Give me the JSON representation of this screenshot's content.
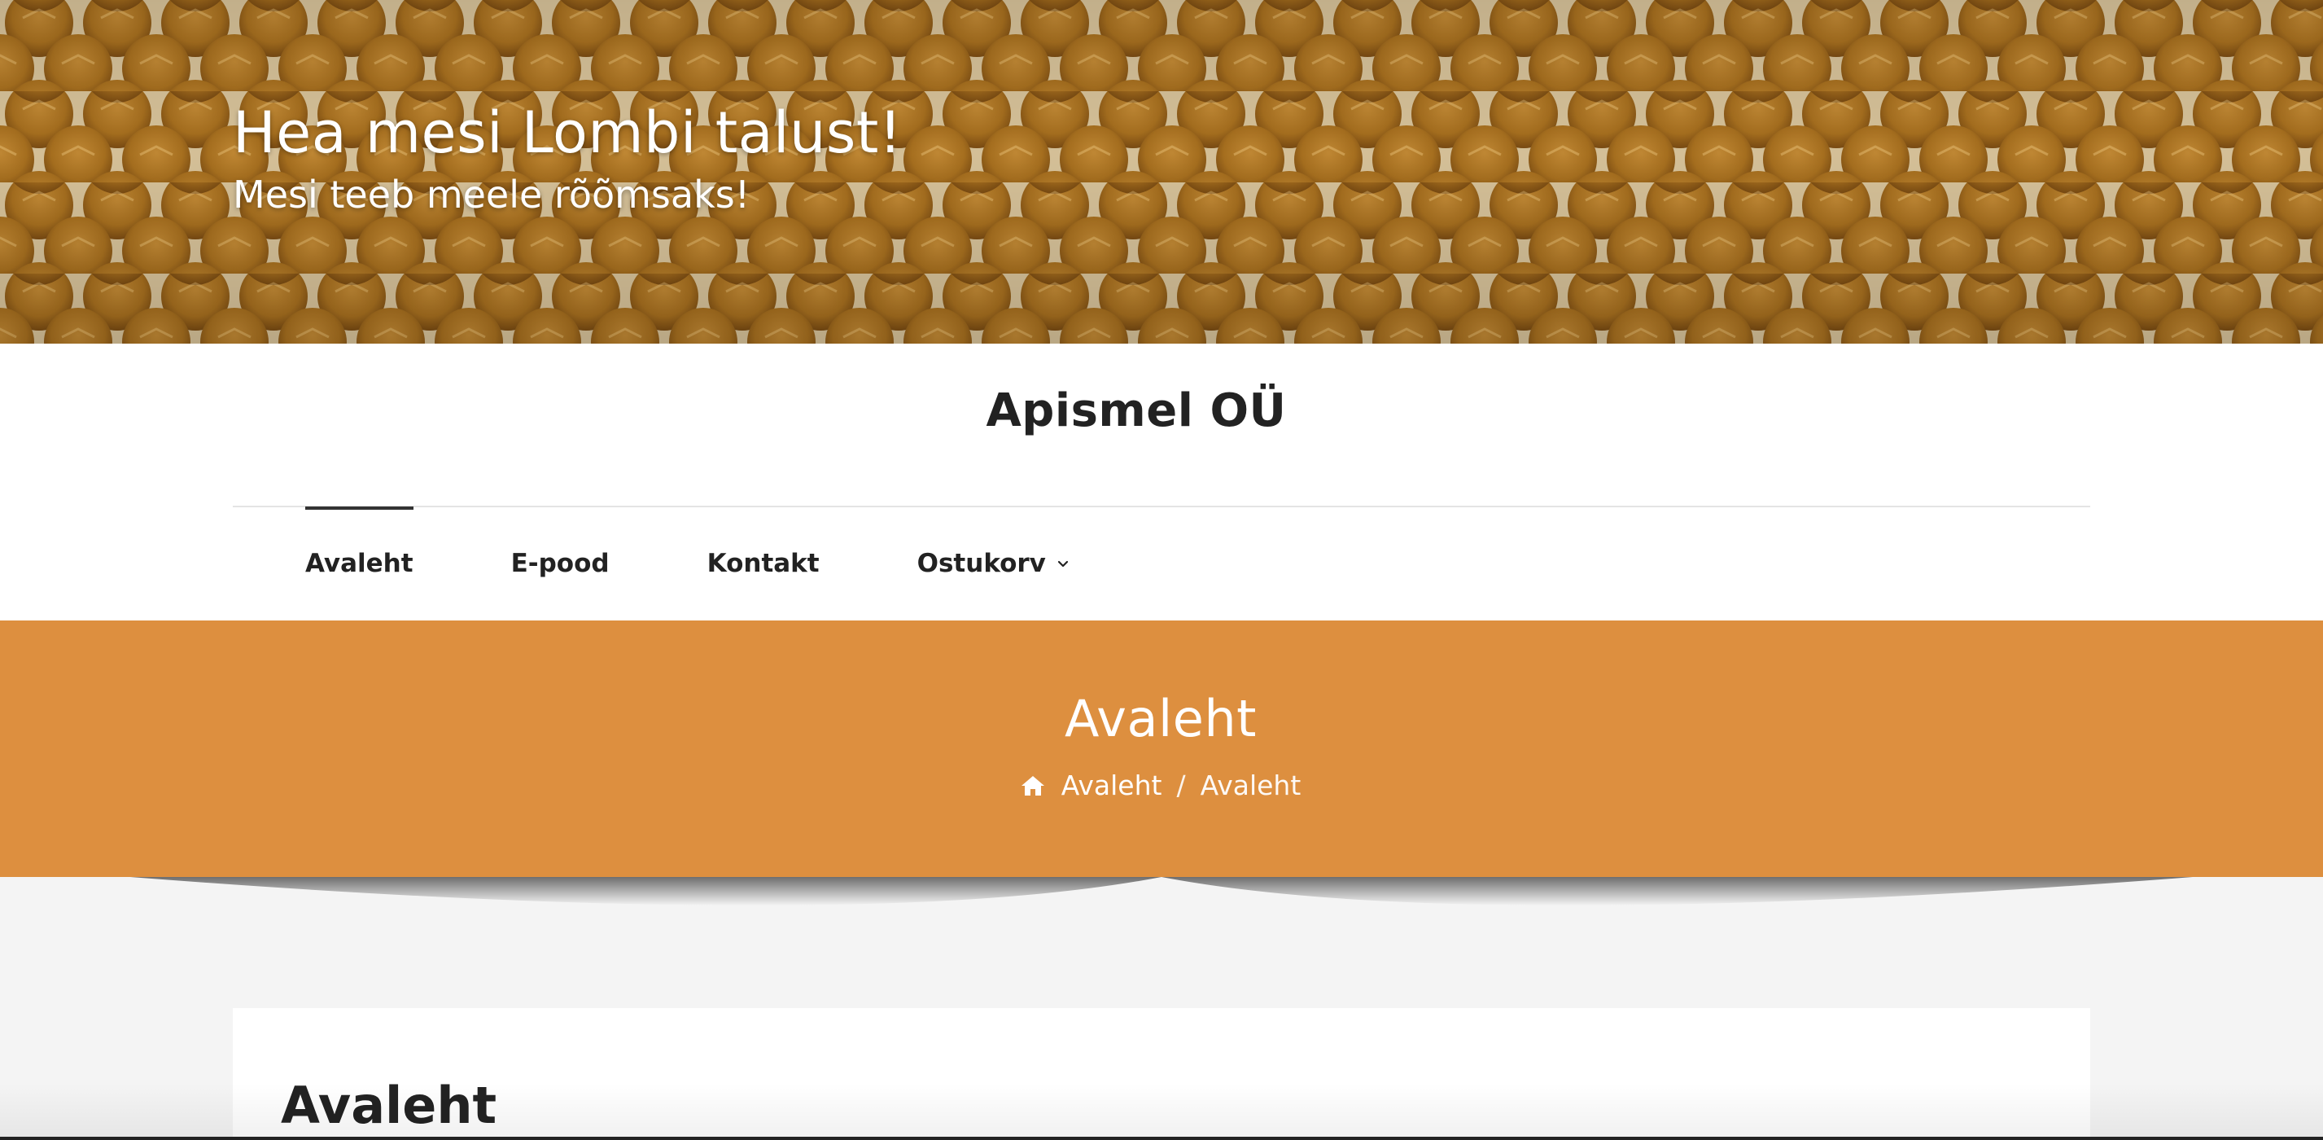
{
  "banner": {
    "title": "Hea mesi Lombi talust!",
    "tagline": "Mesi teeb meele rõõmsaks!",
    "background_image": "honeycomb"
  },
  "header": {
    "site_name": "Apismel OÜ"
  },
  "nav": {
    "items": [
      {
        "label": "Avaleht",
        "active": true
      },
      {
        "label": "E-pood",
        "active": false
      },
      {
        "label": "Kontakt",
        "active": false
      },
      {
        "label": "Ostukorv",
        "active": false,
        "has_dropdown": true,
        "dropdown_icon": "chevron-down-icon"
      }
    ]
  },
  "page_title_band": {
    "title": "Avaleht",
    "breadcrumb": {
      "home_icon": "home-icon",
      "home_label": "Avaleht",
      "separator": "/",
      "current": "Avaleht"
    },
    "color": "#dd8f3f"
  },
  "content": {
    "heading": "Avaleht"
  }
}
